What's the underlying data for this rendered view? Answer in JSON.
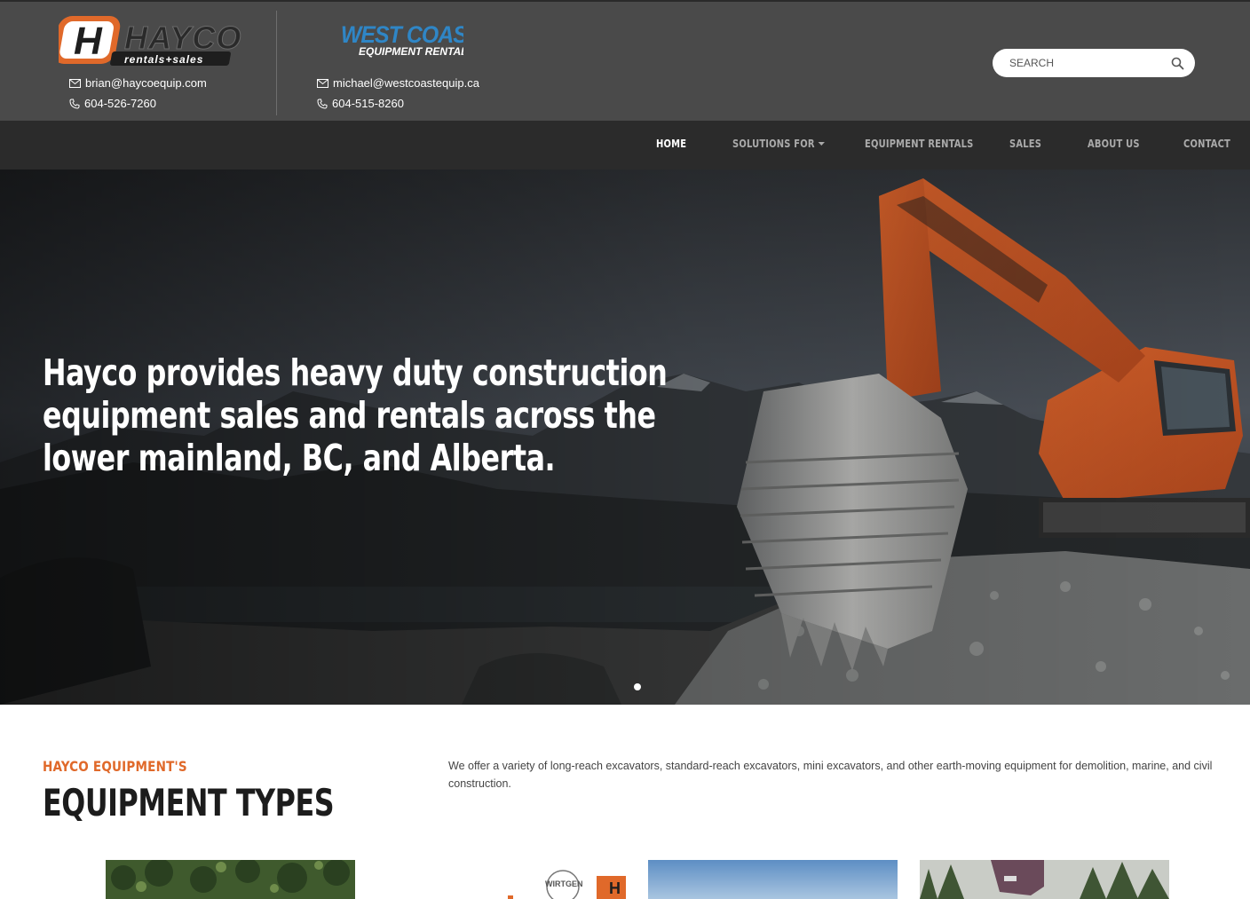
{
  "header": {
    "brands": [
      {
        "name": "Hayco Rentals + Sales",
        "logo_text": "HAYCO",
        "logo_sub": "rentals+sales"
      },
      {
        "name": "West Coast Equipment Rentals",
        "logo_text": "WEST COAST",
        "logo_sub": "EQUIPMENT RENTALS"
      }
    ],
    "contacts": [
      {
        "email": "brian@haycoequip.com",
        "phone": "604-526-7260"
      },
      {
        "email": "michael@westcoastequip.ca",
        "phone": "604-515-8260"
      }
    ],
    "search": {
      "placeholder": "SEARCH",
      "value": ""
    }
  },
  "nav": {
    "items": [
      {
        "label": "HOME",
        "active": true
      },
      {
        "label": "SOLUTIONS FOR",
        "dropdown": true
      },
      {
        "label": "EQUIPMENT RENTALS"
      },
      {
        "label": "SALES"
      },
      {
        "label": "ABOUT US"
      },
      {
        "label": "CONTACT"
      }
    ]
  },
  "hero": {
    "headline_lines": [
      "Hayco provides heavy duty construction",
      "equipment sales and rentals across the",
      "lower mainland, BC, and Alberta."
    ],
    "slide_count": 1,
    "active_slide": 1
  },
  "section": {
    "eyebrow": "HAYCO EQUIPMENT'S",
    "title": "EQUIPMENT TYPES",
    "intro": "We offer a variety of long-reach excavators, standard-reach excavators, mini excavators, and other earth-moving equipment for demolition, marine, and civil construction.",
    "thumb_logo_text": "WIRTGEN GROUP"
  },
  "colors": {
    "header_bg": "#4a4a4a",
    "nav_bg": "#2b2b2b",
    "accent_orange": "#e0692a",
    "westcoast_blue": "#2f86c6"
  }
}
